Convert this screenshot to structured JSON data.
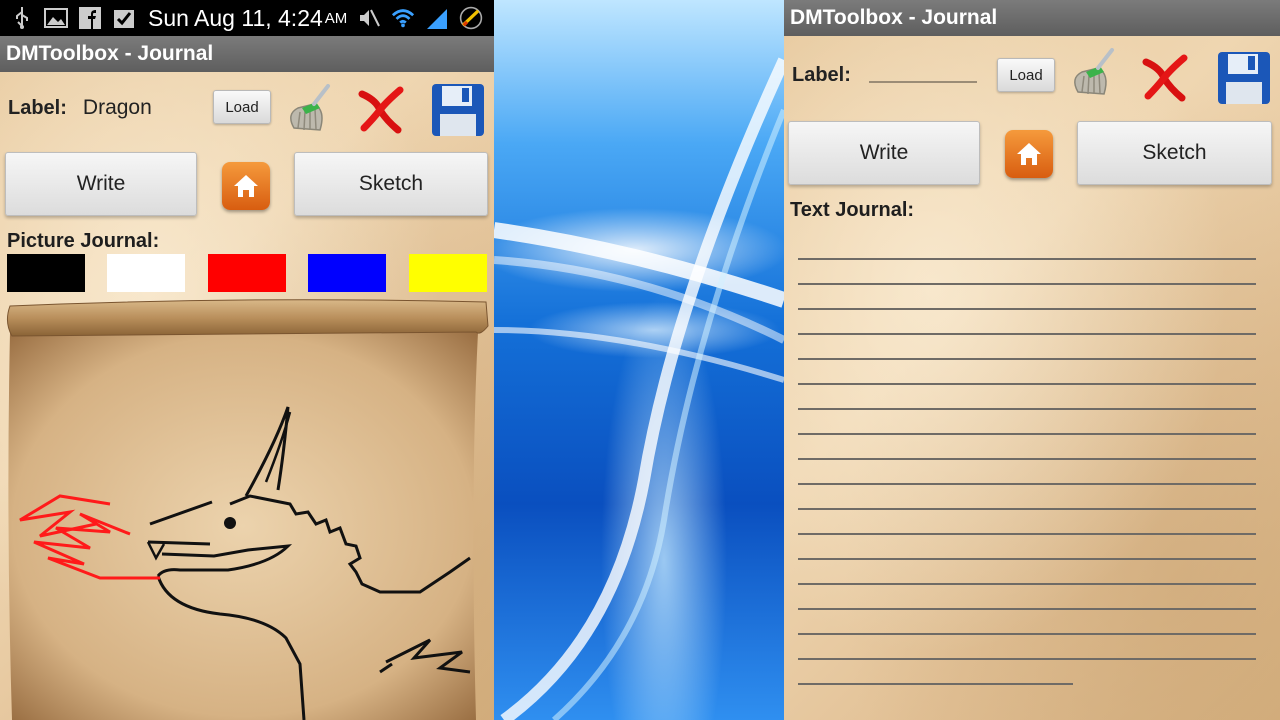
{
  "statusbar": {
    "time": "Sun Aug 11, 4:24",
    "ampm": "AM",
    "icons": [
      "usb-icon",
      "image-icon",
      "facebook-icon",
      "checkbox-icon",
      "mute-icon",
      "wifi-icon",
      "signal-icon",
      "battery-icon"
    ]
  },
  "left_screen": {
    "app_title": "DMToolbox - Journal",
    "label_key": "Label:",
    "label_value": "Dragon",
    "load_label": "Load",
    "write_label": "Write",
    "sketch_label": "Sketch",
    "section_title": "Picture Journal:",
    "swatches": [
      {
        "name": "black",
        "color": "#000000"
      },
      {
        "name": "white",
        "color": "#ffffff"
      },
      {
        "name": "red",
        "color": "#ff0000"
      },
      {
        "name": "blue",
        "color": "#0000ff"
      },
      {
        "name": "yellow",
        "color": "#ffff00"
      }
    ],
    "sketch_colors": {
      "outline": "#111111",
      "fire": "#ff1a1a"
    }
  },
  "right_screen": {
    "app_title": "DMToolbox - Journal",
    "label_key": "Label:",
    "label_value": "",
    "load_label": "Load",
    "write_label": "Write",
    "sketch_label": "Sketch",
    "section_title": "Text Journal:",
    "line_count": 18
  },
  "icons": {
    "broom": "broom-icon",
    "delete": "red-x-icon",
    "save": "floppy-disk-icon",
    "home": "home-icon"
  },
  "colors": {
    "title_bar": "#6b6b6b",
    "parchment": "#e9cda5",
    "home_button": "#e8731f",
    "save_icon": "#1b57b8",
    "delete_icon": "#e01010"
  }
}
